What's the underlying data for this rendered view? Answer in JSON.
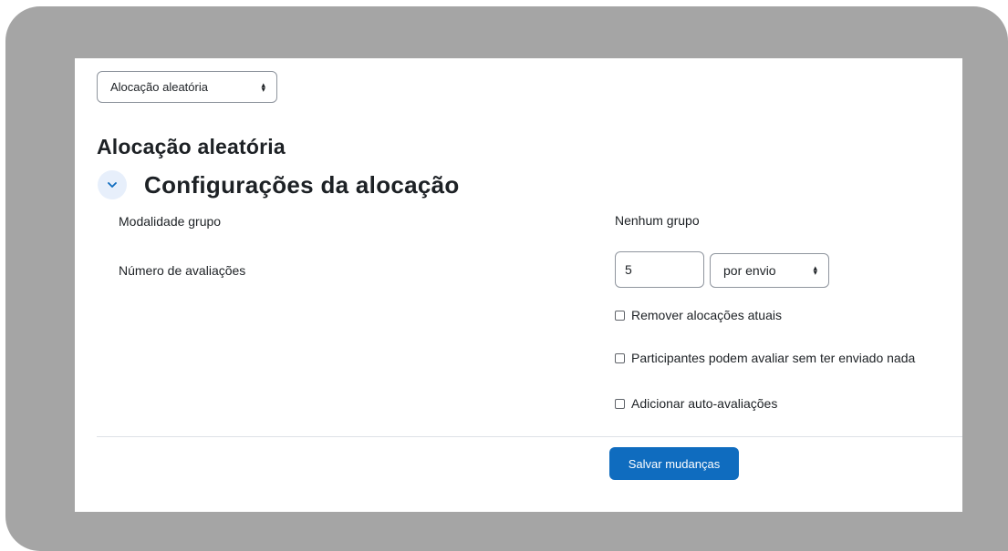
{
  "allocation_select": {
    "selected": "Alocação aleatória"
  },
  "page_title": "Alocação aleatória",
  "section": {
    "title": "Configurações da alocação",
    "expanded": true
  },
  "group_mode": {
    "label": "Modalidade grupo",
    "value": "Nenhum grupo"
  },
  "num_reviews": {
    "label": "Número de avaliações",
    "value": "5",
    "per_selected": "por envio"
  },
  "checkboxes": [
    {
      "label": "Remover alocações atuais",
      "checked": false
    },
    {
      "label": "Participantes podem avaliar sem ter enviado nada",
      "checked": false
    },
    {
      "label": "Adicionar auto-avaliações",
      "checked": false
    }
  ],
  "save_label": "Salvar mudanças",
  "colors": {
    "frame": "#a5a5a5",
    "primary": "#0f6cbf",
    "text": "#1d2125",
    "toggle_bg": "#e7effb"
  },
  "icons": {
    "section_toggle": "chevron-down-icon",
    "select_caret": "select-arrows-icon"
  }
}
